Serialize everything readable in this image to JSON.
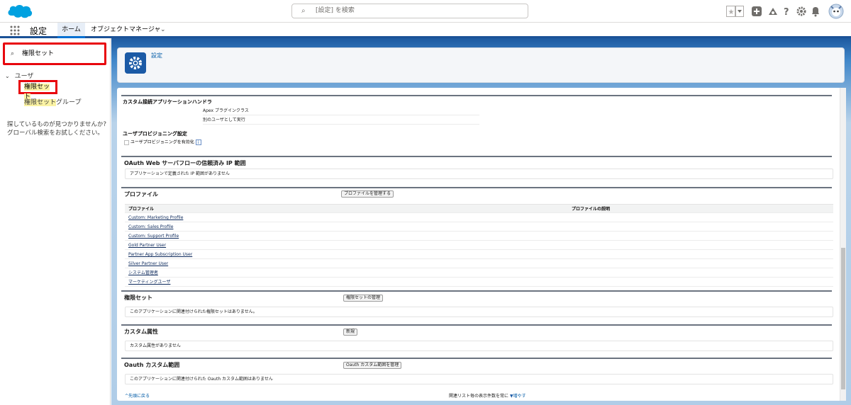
{
  "topbar": {
    "search_placeholder": "[設定] を検索"
  },
  "navbar": {
    "app_name": "設定",
    "tab_home": "ホーム",
    "tab_object_manager": "オブジェクトマネージャ"
  },
  "left": {
    "search_value": "権限セット",
    "tree_parent": "ユーザ",
    "items": [
      {
        "label_hl": "権限セット",
        "label_rest": ""
      },
      {
        "label_hl": "権限セット",
        "label_rest": "グループ"
      }
    ],
    "no_result": "探しているものが見つかりませんか? グローバル検索をお試しください。"
  },
  "header": {
    "breadcrumb": "設定"
  },
  "content": {
    "connected_app_handler": {
      "title": "カスタム接続アプリケーションハンドラ",
      "apex_label": "Apex プラグインクラス",
      "run_as_label": "別のユーザとして実行"
    },
    "user_provisioning": {
      "title": "ユーザプロビジョニング設定",
      "checkbox_label": "ユーザプロビジョニングを有効化"
    },
    "oauth_ip": {
      "title": "OAuth Web サーバフローの信頼済み IP 範囲",
      "message": "アプリケーションで定義された IP 範囲がありません"
    },
    "profiles": {
      "title": "プロファイル",
      "manage_button": "プロファイルを管理する",
      "col_profile": "プロファイル",
      "col_description": "プロファイルの説明",
      "rows": [
        "Custom: Marketing Profile",
        "Custom: Sales Profile",
        "Custom: Support Profile",
        "Gold Partner User",
        "Partner App Subscription User",
        "Silver Partner User",
        "システム管理者",
        "マーケティングユーザ"
      ]
    },
    "permission_sets": {
      "title": "権限セット",
      "manage_button": "権限セットの管理",
      "message": "このアプリケーションに関連付けられた権限セットはありません。"
    },
    "custom_attributes": {
      "title": "カスタム属性",
      "new_button": "新規",
      "message": "カスタム属性がありません"
    },
    "oauth_scopes": {
      "title": "Oauth カスタム範囲",
      "manage_button": "Oauth カスタム範囲を管理",
      "message": "このアプリケーションに関連付けられた Oauth カスタム範囲はありません"
    },
    "footer": {
      "back_to_top": "^先頭に戻る",
      "related_list_text": "関連リスト毎の表示件数を常に",
      "increase": "増やす"
    }
  },
  "colors": {
    "brand": "#1b5297",
    "link": "#015ba7",
    "highlight_border": "#e8060d",
    "search_highlight": "#fbf3a4"
  }
}
